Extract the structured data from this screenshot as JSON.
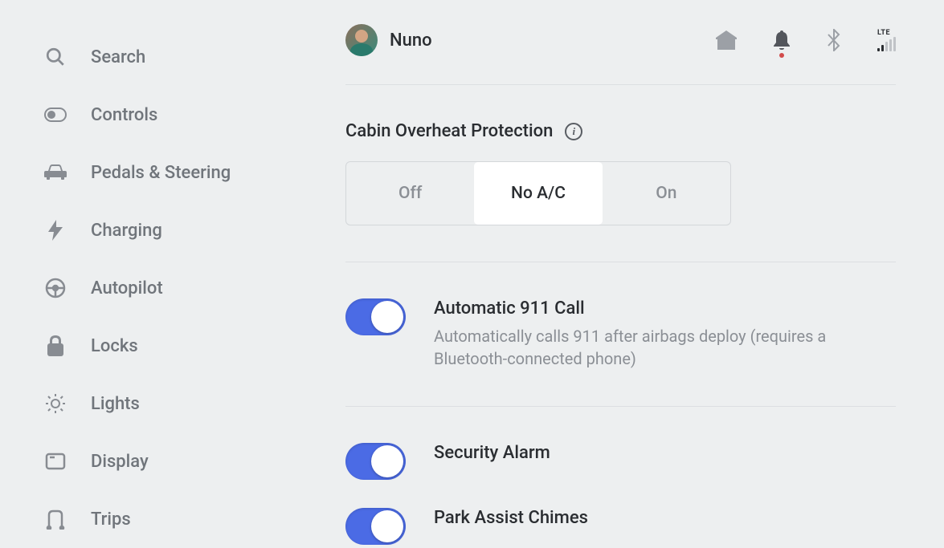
{
  "header": {
    "username": "Nuno",
    "signal_label": "LTE"
  },
  "sidebar": {
    "items": [
      {
        "label": "Search"
      },
      {
        "label": "Controls"
      },
      {
        "label": "Pedals & Steering"
      },
      {
        "label": "Charging"
      },
      {
        "label": "Autopilot"
      },
      {
        "label": "Locks"
      },
      {
        "label": "Lights"
      },
      {
        "label": "Display"
      },
      {
        "label": "Trips"
      }
    ]
  },
  "overheat": {
    "title": "Cabin Overheat Protection",
    "options": [
      "Off",
      "No A/C",
      "On"
    ],
    "selected": "No A/C"
  },
  "toggles": {
    "auto911": {
      "title": "Automatic 911 Call",
      "desc": "Automatically calls 911 after airbags deploy (requires a Bluetooth-connected phone)",
      "value": true
    },
    "alarm": {
      "title": "Security Alarm",
      "value": true
    },
    "parkassist": {
      "title": "Park Assist Chimes",
      "value": true
    }
  }
}
